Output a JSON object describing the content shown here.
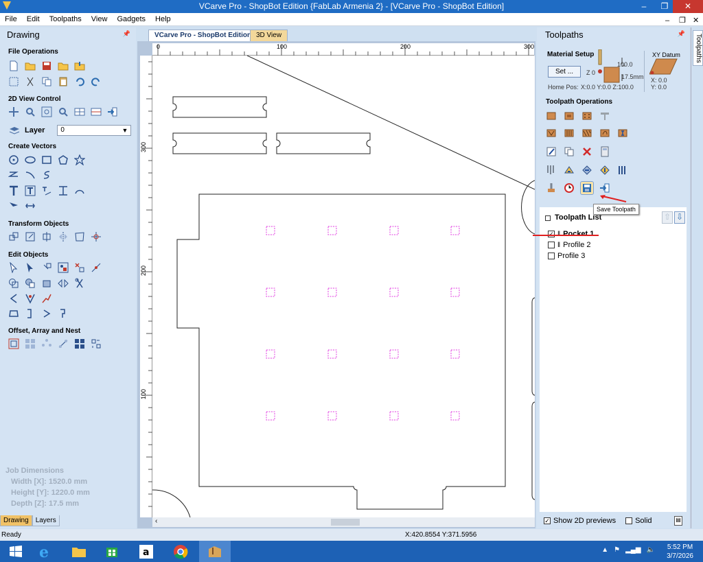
{
  "window": {
    "title": "VCarve Pro - ShopBot Edition {FabLab Armenia 2} - [VCarve Pro - ShopBot Edition]"
  },
  "menu": [
    "File",
    "Edit",
    "Toolpaths",
    "View",
    "Gadgets",
    "Help"
  ],
  "left_panel": {
    "title": "Drawing",
    "sections": {
      "file_ops": "File Operations",
      "view_control": "2D View Control",
      "create_vectors": "Create Vectors",
      "transform": "Transform Objects",
      "edit": "Edit Objects",
      "offset": "Offset, Array and Nest"
    },
    "layer_label": "Layer",
    "layer_value": "0",
    "job_dimensions": {
      "title": "Job Dimensions",
      "width": "Width  [X]: 1520.0 mm",
      "height": "Height [Y]: 1220.0 mm",
      "depth": "Depth  [Z]: 17.5 mm"
    },
    "tabs": [
      "Drawing",
      "Layers"
    ]
  },
  "view_tabs": [
    "VCarve Pro - ShopBot Edition",
    "3D View"
  ],
  "ruler": {
    "top": [
      "0",
      "100",
      "200",
      "300"
    ],
    "left": [
      "300",
      "200",
      "100"
    ]
  },
  "right_panel": {
    "title": "Toolpaths",
    "side_tab": "Toolpaths",
    "material_setup": "Material Setup",
    "set_button": "Set ...",
    "z0": "Z 0",
    "dim_top": "100.0",
    "dim_thick": "17.5mm",
    "home_pos": "Home Pos:",
    "home_vals": "X:0.0 Y:0.0 Z:100.0",
    "xy_datum": "XY Datum",
    "datum_x": "X: 0.0",
    "datum_y": "Y: 0.0",
    "toolpath_ops": "Toolpath Operations",
    "tooltip": "Save Toolpath",
    "list_title": "Toolpath List",
    "items": [
      {
        "name": "Pocket 1",
        "checked": "✓"
      },
      {
        "name": "Profile 2",
        "checked": ""
      },
      {
        "name": "Profile 3",
        "checked": ""
      }
    ],
    "show_previews": "Show 2D previews",
    "solid": "Solid"
  },
  "status": {
    "left": "Ready",
    "coords": "X:420.8554 Y:371.5956"
  },
  "clock": {
    "time": "5:52 PM",
    "date": "3/7/2026"
  }
}
